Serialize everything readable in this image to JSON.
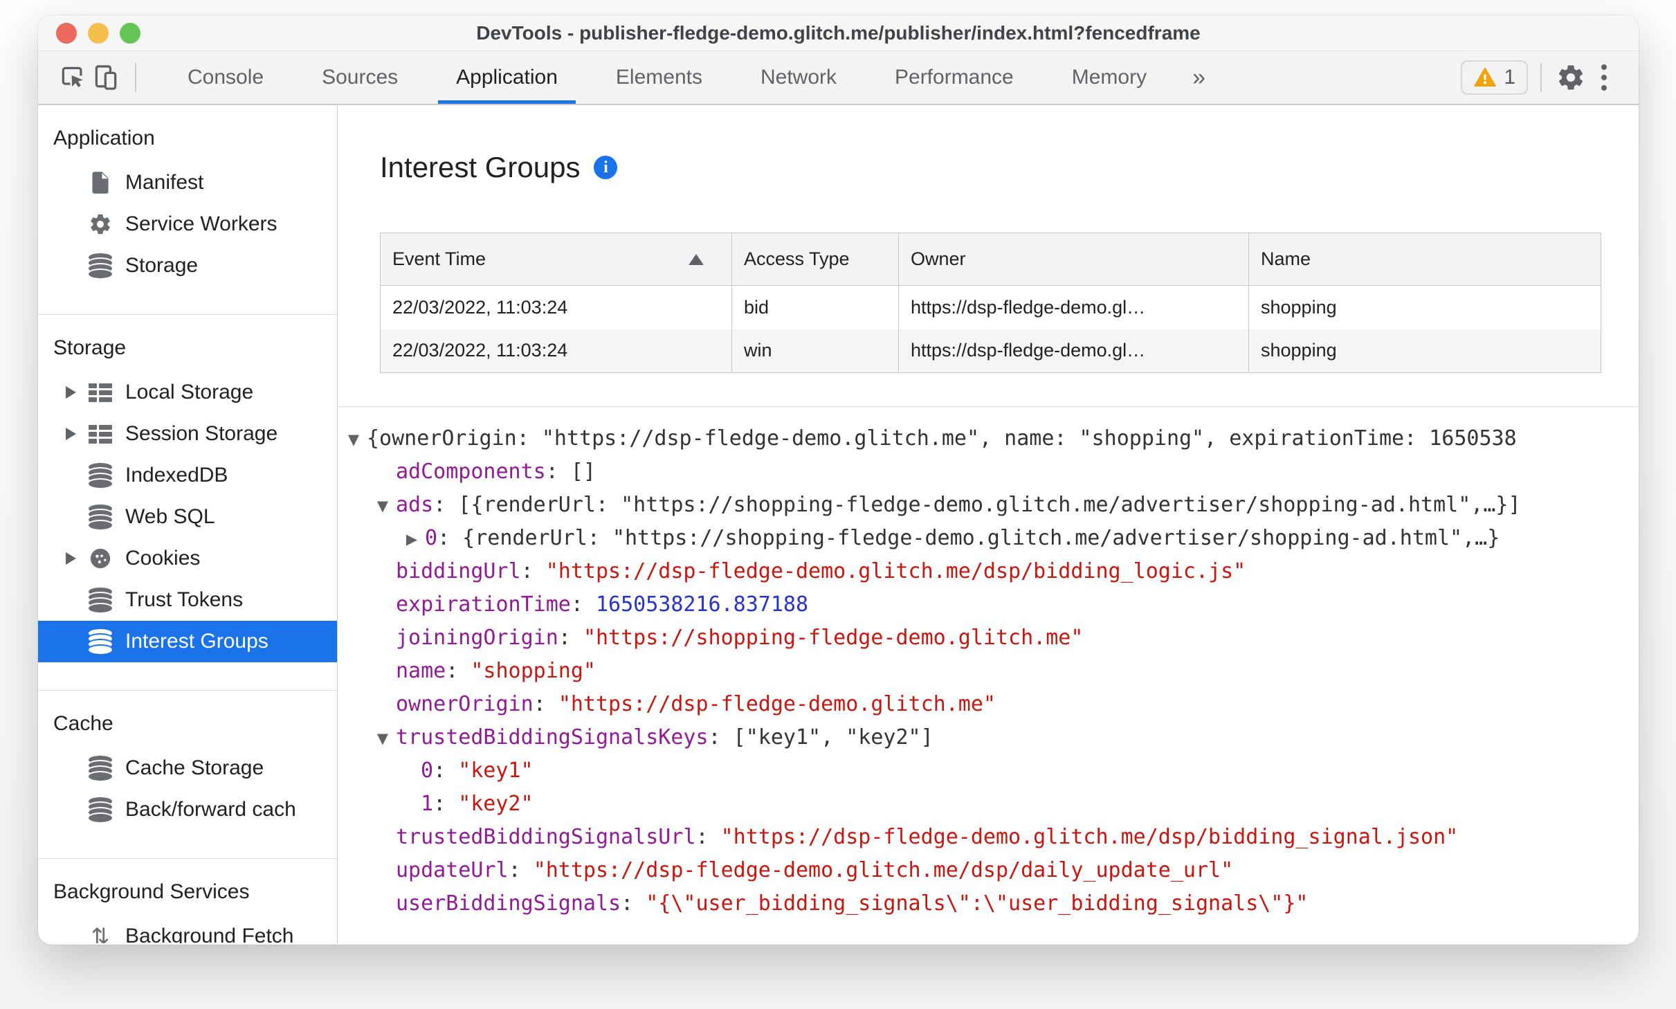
{
  "window": {
    "title": "DevTools - publisher-fledge-demo.glitch.me/publisher/index.html?fencedframe"
  },
  "toolbar": {
    "tabs": [
      "Console",
      "Sources",
      "Application",
      "Elements",
      "Network",
      "Performance",
      "Memory"
    ],
    "active_tab": "Application",
    "more_tabs_glyph": "»",
    "warning_count": "1",
    "accent_color": "#1a73e8"
  },
  "sidebar": {
    "sections": [
      {
        "title": "Application",
        "items": [
          {
            "label": "Manifest"
          },
          {
            "label": "Service Workers"
          },
          {
            "label": "Storage"
          }
        ]
      },
      {
        "title": "Storage",
        "items": [
          {
            "label": "Local Storage"
          },
          {
            "label": "Session Storage"
          },
          {
            "label": "IndexedDB"
          },
          {
            "label": "Web SQL"
          },
          {
            "label": "Cookies"
          },
          {
            "label": "Trust Tokens"
          },
          {
            "label": "Interest Groups",
            "selected": true
          }
        ]
      },
      {
        "title": "Cache",
        "items": [
          {
            "label": "Cache Storage"
          },
          {
            "label": "Back/forward cach"
          }
        ]
      },
      {
        "title": "Background Services",
        "items": [
          {
            "label": "Background Fetch"
          }
        ]
      }
    ],
    "selected_color": "#1a73e8"
  },
  "main": {
    "heading": "Interest Groups",
    "table": {
      "columns": [
        "Event Time",
        "Access Type",
        "Owner",
        "Name"
      ],
      "sorted_column": "Event Time",
      "sort_direction": "ascending",
      "rows": [
        {
          "event_time": "22/03/2022, 11:03:24",
          "access_type": "bid",
          "owner": "https://dsp-fledge-demo.gl…",
          "name": "shopping"
        },
        {
          "event_time": "22/03/2022, 11:03:24",
          "access_type": "win",
          "owner": "https://dsp-fledge-demo.gl…",
          "name": "shopping"
        }
      ]
    }
  },
  "tree": {
    "lines": [
      {
        "indent": "root",
        "arrow": "open",
        "parts": [
          {
            "c": "plain",
            "t": "{ownerOrigin: \"https://dsp-fledge-demo.glitch.me\", name: \"shopping\", expirationTime: 1650538"
          }
        ]
      },
      {
        "indent": "l1",
        "arrow": "none",
        "parts": [
          {
            "c": "key",
            "t": "adComponents"
          },
          {
            "c": "plain",
            "t": ": []"
          }
        ]
      },
      {
        "indent": "l1",
        "arrow": "open",
        "parts": [
          {
            "c": "key",
            "t": "ads"
          },
          {
            "c": "plain",
            "t": ": [{renderUrl: \"https://shopping-fledge-demo.glitch.me/advertiser/shopping-ad.html\",…}]"
          }
        ]
      },
      {
        "indent": "l2",
        "arrow": "closed",
        "parts": [
          {
            "c": "key",
            "t": "0"
          },
          {
            "c": "plain",
            "t": ": {renderUrl: \"https://shopping-fledge-demo.glitch.me/advertiser/shopping-ad.html\",…}"
          }
        ]
      },
      {
        "indent": "l1",
        "arrow": "none",
        "parts": [
          {
            "c": "key",
            "t": "biddingUrl"
          },
          {
            "c": "plain",
            "t": ": "
          },
          {
            "c": "str",
            "t": "\"https://dsp-fledge-demo.glitch.me/dsp/bidding_logic.js\""
          }
        ]
      },
      {
        "indent": "l1",
        "arrow": "none",
        "parts": [
          {
            "c": "key",
            "t": "expirationTime"
          },
          {
            "c": "plain",
            "t": ": "
          },
          {
            "c": "num",
            "t": "1650538216.837188"
          }
        ]
      },
      {
        "indent": "l1",
        "arrow": "none",
        "parts": [
          {
            "c": "key",
            "t": "joiningOrigin"
          },
          {
            "c": "plain",
            "t": ": "
          },
          {
            "c": "str",
            "t": "\"https://shopping-fledge-demo.glitch.me\""
          }
        ]
      },
      {
        "indent": "l1",
        "arrow": "none",
        "parts": [
          {
            "c": "key",
            "t": "name"
          },
          {
            "c": "plain",
            "t": ": "
          },
          {
            "c": "str",
            "t": "\"shopping\""
          }
        ]
      },
      {
        "indent": "l1",
        "arrow": "none",
        "parts": [
          {
            "c": "key",
            "t": "ownerOrigin"
          },
          {
            "c": "plain",
            "t": ": "
          },
          {
            "c": "str",
            "t": "\"https://dsp-fledge-demo.glitch.me\""
          }
        ]
      },
      {
        "indent": "l1",
        "arrow": "open",
        "parts": [
          {
            "c": "key",
            "t": "trustedBiddingSignalsKeys"
          },
          {
            "c": "plain",
            "t": ": [\"key1\", \"key2\"]"
          }
        ]
      },
      {
        "indent": "l2b",
        "arrow": "none",
        "parts": [
          {
            "c": "key",
            "t": "0"
          },
          {
            "c": "plain",
            "t": ": "
          },
          {
            "c": "str",
            "t": "\"key1\""
          }
        ]
      },
      {
        "indent": "l2b",
        "arrow": "none",
        "parts": [
          {
            "c": "key",
            "t": "1"
          },
          {
            "c": "plain",
            "t": ": "
          },
          {
            "c": "str",
            "t": "\"key2\""
          }
        ]
      },
      {
        "indent": "l1",
        "arrow": "none",
        "parts": [
          {
            "c": "key",
            "t": "trustedBiddingSignalsUrl"
          },
          {
            "c": "plain",
            "t": ": "
          },
          {
            "c": "str",
            "t": "\"https://dsp-fledge-demo.glitch.me/dsp/bidding_signal.json\""
          }
        ]
      },
      {
        "indent": "l1",
        "arrow": "none",
        "parts": [
          {
            "c": "key",
            "t": "updateUrl"
          },
          {
            "c": "plain",
            "t": ": "
          },
          {
            "c": "str",
            "t": "\"https://dsp-fledge-demo.glitch.me/dsp/daily_update_url\""
          }
        ]
      },
      {
        "indent": "l1",
        "arrow": "none",
        "parts": [
          {
            "c": "key",
            "t": "userBiddingSignals"
          },
          {
            "c": "plain",
            "t": ": "
          },
          {
            "c": "str",
            "t": "\"{\\\"user_bidding_signals\\\":\\\"user_bidding_signals\\\"}\""
          }
        ]
      }
    ]
  }
}
